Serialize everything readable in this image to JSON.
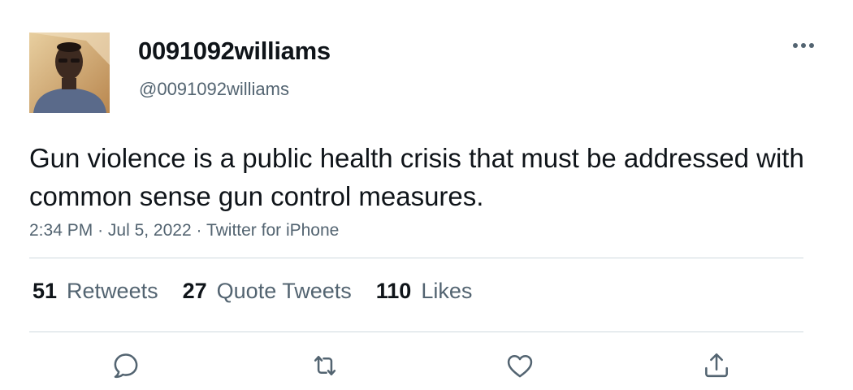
{
  "user": {
    "display_name": "0091092williams",
    "handle": "@0091092williams",
    "avatar_icon": "profile-photo"
  },
  "tweet": {
    "text": "Gun violence is a public health crisis that must be addressed with common sense gun control measures."
  },
  "meta": {
    "time": "2:34 PM",
    "separator": "·",
    "date": "Jul 5, 2022",
    "source": "Twitter for iPhone"
  },
  "stats": [
    {
      "count": "51",
      "label": "Retweets"
    },
    {
      "count": "27",
      "label": "Quote Tweets"
    },
    {
      "count": "110",
      "label": "Likes"
    }
  ],
  "actions": [
    "reply-icon",
    "retweet-icon",
    "like-icon",
    "share-icon"
  ],
  "colors": {
    "text": "#0f1419",
    "secondary": "#536471",
    "divider": "#cfd9de",
    "background": "#ffffff"
  }
}
